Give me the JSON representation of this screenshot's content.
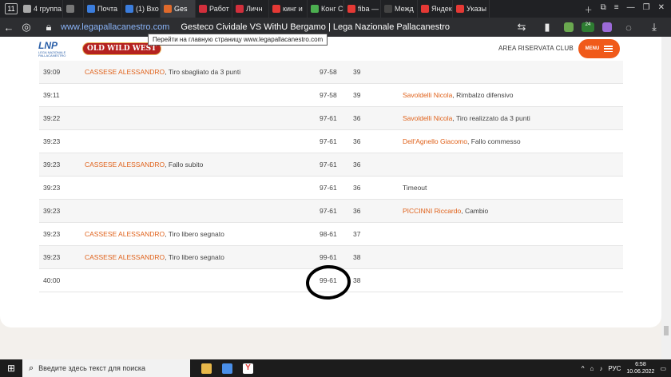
{
  "browser": {
    "tab_count": "11",
    "tabs": [
      {
        "label": "4 группа 1",
        "color": "#aaaaaa"
      },
      {
        "label": "",
        "color": "#777777"
      },
      {
        "label": "Почта",
        "color": "#3b7ddd"
      },
      {
        "label": "(1) Вхо",
        "color": "#3b7ddd"
      },
      {
        "label": "Ges",
        "color": "#e06a2c"
      },
      {
        "label": "Работ",
        "color": "#d22f3c"
      },
      {
        "label": "Личн",
        "color": "#d22f3c"
      },
      {
        "label": "кинг и",
        "color": "#e53935"
      },
      {
        "label": "Конг С",
        "color": "#4caf50"
      },
      {
        "label": "fiba —",
        "color": "#e53935"
      },
      {
        "label": "Межд",
        "color": "#444444"
      },
      {
        "label": "Яндек",
        "color": "#e53935"
      },
      {
        "label": "Указы",
        "color": "#e53935"
      }
    ],
    "url": "www.legapallacanestro.com",
    "page_title": "Gesteco Cividale VS WithU Bergamo | Lega Nazionale Pallacanestro",
    "tooltip": "Перейти на главную страницу www.legapallacanestro.com",
    "badge_count": "24"
  },
  "site": {
    "logo_text": "LNP",
    "logo_sub": "LEGA NAZIONALE PALLACANESTRO",
    "sponsor": "OLD WILD WEST",
    "area_link": "AREA RISERVATA CLUB",
    "menu_label": "MENU"
  },
  "play_by_play": [
    {
      "time": "39:09",
      "home_player": "CASSESE ALESSANDRO",
      "home_action": ", Tiro sbagliato da 3 punti",
      "score": "97-58",
      "diff": "39",
      "away_player": "",
      "away_action": ""
    },
    {
      "time": "39:11",
      "home_player": "",
      "home_action": "",
      "score": "97-58",
      "diff": "39",
      "away_player": "Savoldelli Nicola",
      "away_action": ", Rimbalzo difensivo"
    },
    {
      "time": "39:22",
      "home_player": "",
      "home_action": "",
      "score": "97-61",
      "diff": "36",
      "away_player": "Savoldelli Nicola",
      "away_action": ", Tiro realizzato da 3 punti"
    },
    {
      "time": "39:23",
      "home_player": "",
      "home_action": "",
      "score": "97-61",
      "diff": "36",
      "away_player": "Dell'Agnello Giacomo",
      "away_action": ", Fallo commesso"
    },
    {
      "time": "39:23",
      "home_player": "CASSESE ALESSANDRO",
      "home_action": ", Fallo subito",
      "score": "97-61",
      "diff": "36",
      "away_player": "",
      "away_action": ""
    },
    {
      "time": "39:23",
      "home_player": "",
      "home_action": "",
      "score": "97-61",
      "diff": "36",
      "away_player": "",
      "away_action": "Timeout"
    },
    {
      "time": "39:23",
      "home_player": "",
      "home_action": "",
      "score": "97-61",
      "diff": "36",
      "away_player": "PICCINNI Riccardo",
      "away_action": ", Cambio"
    },
    {
      "time": "39:23",
      "home_player": "CASSESE ALESSANDRO",
      "home_action": ", Tiro libero segnato",
      "score": "98-61",
      "diff": "37",
      "away_player": "",
      "away_action": ""
    },
    {
      "time": "39:23",
      "home_player": "CASSESE ALESSANDRO",
      "home_action": ", Tiro libero segnato",
      "score": "99-61",
      "diff": "38",
      "away_player": "",
      "away_action": ""
    },
    {
      "time": "40:00",
      "home_player": "",
      "home_action": "",
      "score": "99-61",
      "diff": "38",
      "away_player": "",
      "away_action": ""
    }
  ],
  "taskbar": {
    "search_placeholder": "Введите здесь текст для поиска",
    "language": "РУС",
    "time": "6:58",
    "date": "10.06.2022"
  }
}
